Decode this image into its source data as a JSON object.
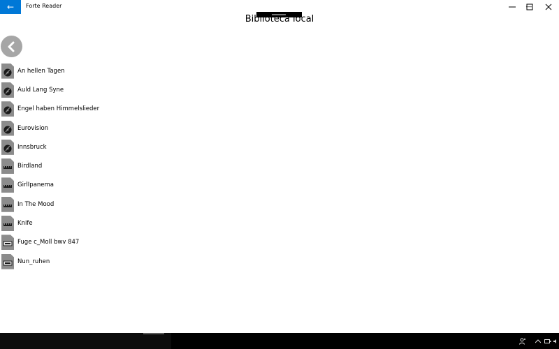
{
  "window": {
    "title": "Forte Reader",
    "back_glyph": "←",
    "minimize_glyph": "—",
    "maximize_glyph": "☐",
    "close_glyph": "✕"
  },
  "page": {
    "title": "Biblioteca local"
  },
  "files": [
    {
      "name": "An hellen Tagen",
      "icon": "audio-file-icon"
    },
    {
      "name": "Auld Lang Syne",
      "icon": "audio-file-icon"
    },
    {
      "name": "Engel haben Himmelslieder",
      "icon": "audio-file-icon"
    },
    {
      "name": "Eurovision",
      "icon": "audio-file-icon"
    },
    {
      "name": "Innsbruck",
      "icon": "audio-file-icon"
    },
    {
      "name": "Birdland",
      "icon": "midi-file-icon"
    },
    {
      "name": "GirlIpanema",
      "icon": "midi-file-icon"
    },
    {
      "name": "In The Mood",
      "icon": "midi-file-icon"
    },
    {
      "name": "Knife",
      "icon": "midi-file-icon"
    },
    {
      "name": "Fuge c_Moll bwv 847",
      "icon": "score-file-icon"
    },
    {
      "name": "Nun_ruhen",
      "icon": "score-file-icon"
    }
  ],
  "taskbar": {
    "people_glyph": "⚇",
    "chevron_glyph": "^"
  },
  "colors": {
    "accent": "#0078d7",
    "icon_gray": "#8c8c8c",
    "nav_circle": "#a6a6a6"
  }
}
